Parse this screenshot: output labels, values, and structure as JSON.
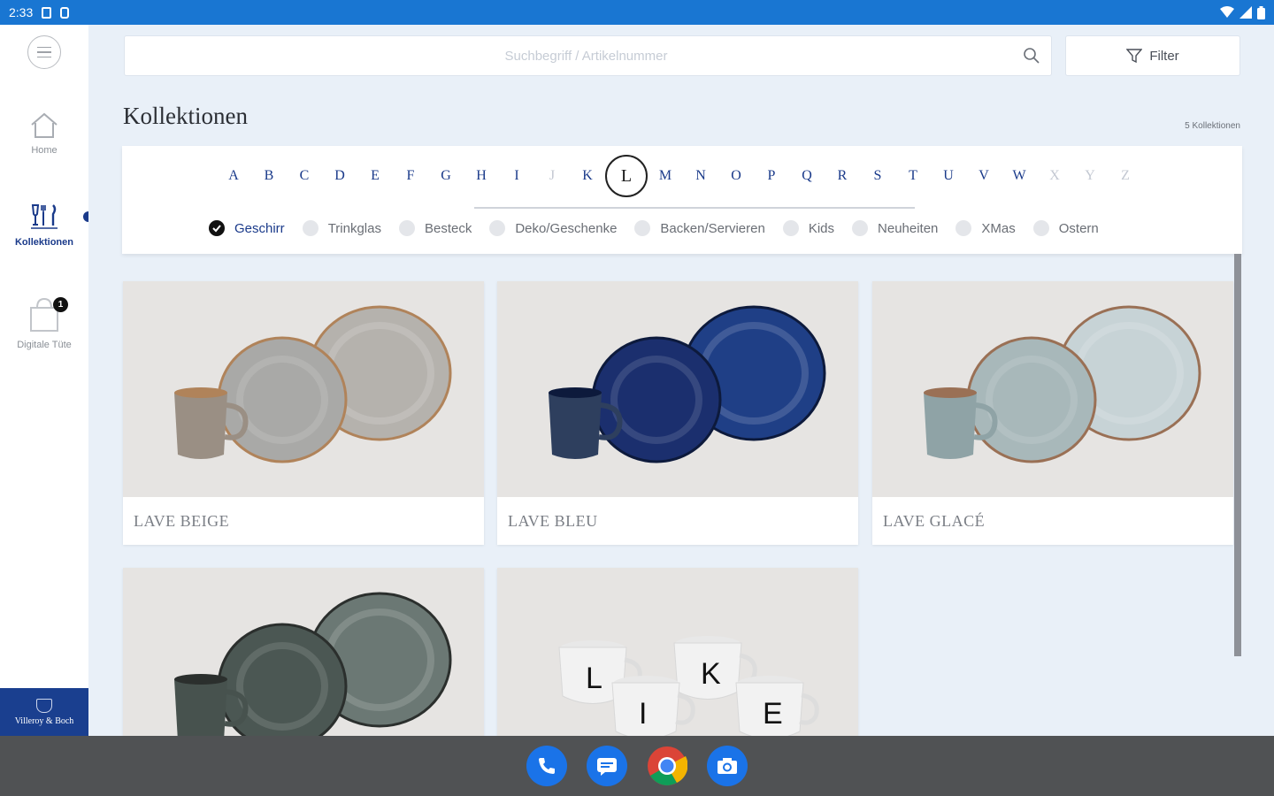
{
  "status_bar": {
    "time": "2:33"
  },
  "sidebar": {
    "items": [
      {
        "label": "Home",
        "icon": "home-icon"
      },
      {
        "label": "Kollektionen",
        "icon": "tableware-icon",
        "active": true
      },
      {
        "label": "Digitale Tüte",
        "icon": "bag-icon",
        "badge": "1"
      }
    ],
    "brand": {
      "name": "Villeroy & Boch"
    }
  },
  "search": {
    "placeholder": "Suchbegriff / Artikelnummer",
    "value": ""
  },
  "filter_button": {
    "label": "Filter"
  },
  "page": {
    "title": "Kollektionen",
    "count_label": "5 Kollektionen"
  },
  "alphabet": {
    "letters": [
      "A",
      "B",
      "C",
      "D",
      "E",
      "F",
      "G",
      "H",
      "I",
      "J",
      "K",
      "L",
      "M",
      "N",
      "O",
      "P",
      "Q",
      "R",
      "S",
      "T",
      "U",
      "V",
      "W",
      "X",
      "Y",
      "Z"
    ],
    "disabled": [
      "J",
      "X",
      "Y",
      "Z"
    ],
    "selected": "L"
  },
  "categories": [
    {
      "label": "Geschirr",
      "checked": true
    },
    {
      "label": "Trinkglas",
      "checked": false
    },
    {
      "label": "Besteck",
      "checked": false
    },
    {
      "label": "Deko/Geschenke",
      "checked": false
    },
    {
      "label": "Backen/Servieren",
      "checked": false
    },
    {
      "label": "Kids",
      "checked": false
    },
    {
      "label": "Neuheiten",
      "checked": false
    },
    {
      "label": "XMas",
      "checked": false
    },
    {
      "label": "Ostern",
      "checked": false
    }
  ],
  "collections": [
    {
      "name": "LAVE BEIGE",
      "palette": {
        "mug": "#9a8f84",
        "plate": "#a9a9a7",
        "rim": "#b0835a",
        "plate2": "#b5b2ad"
      }
    },
    {
      "name": "LAVE BLEU",
      "palette": {
        "mug": "#2e3f5e",
        "plate": "#1b2f6e",
        "rim": "#0d1a3c",
        "plate2": "#1f3f86"
      }
    },
    {
      "name": "LAVE GLACÉ",
      "palette": {
        "mug": "#8fa3a6",
        "plate": "#a8b8ba",
        "rim": "#9a7055",
        "plate2": "#c7d3d6"
      }
    },
    {
      "name": "",
      "palette": {
        "mug": "#47524e",
        "plate": "#4b5753",
        "rim": "#2b2f2d",
        "plate2": "#6b7874"
      }
    },
    {
      "name": "",
      "palette": {
        "mug": "#f2f2f2",
        "plate": "#f4f4f4",
        "rim": "#d0d0d0",
        "plate2": "#f0f0f0"
      }
    }
  ],
  "cup_letters": [
    "L",
    "K",
    "I",
    "E"
  ],
  "dock": [
    {
      "icon": "phone-icon",
      "color": "#1a73e8"
    },
    {
      "icon": "messages-icon",
      "color": "#1a73e8"
    },
    {
      "icon": "chrome-icon",
      "color": "#ffffff"
    },
    {
      "icon": "camera-icon",
      "color": "#1a73e8"
    }
  ]
}
